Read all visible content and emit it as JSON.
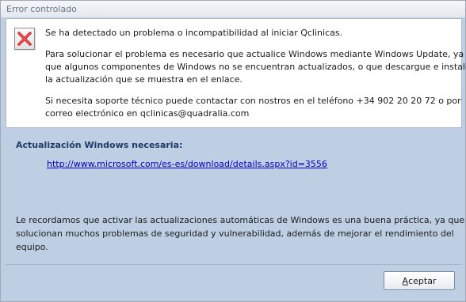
{
  "window": {
    "title": "Error controlado"
  },
  "message": {
    "icon": "error-x-icon",
    "line1": "Se ha detectado un problema o incompatibilidad al iniciar Qclinicas.",
    "para2": [
      "Para solucionar el problema es necesario que actualice Windows mediante Windows Update, ya",
      "que algunos componentes de Windows no se encuentran actualizados, o que descargue e instale",
      "la actualización que se muestra en el enlace."
    ],
    "para3": [
      "Si necesita soporte técnico puede contactar con nostros en el teléfono +34 902 20 20 72 o por",
      "correo electrónico en qclinicas@quadralia.com"
    ]
  },
  "update": {
    "heading": "Actualización Windows necesaria:",
    "link": "http://www.microsoft.com/es-es/download/details.aspx?id=3556"
  },
  "info": [
    "Le recordamos que activar las actualizaciones automáticas de Windows es una buena práctica, ya que se",
    "solucionan muchos problemas de seguridad y vulnerabilidad, además de mejorar el rendimiento del",
    "equipo."
  ],
  "buttons": {
    "accept_first": "A",
    "accept_rest": "ceptar"
  },
  "colors": {
    "panel_bg": "#bfcfe3",
    "heading": "#1d3b6a",
    "link": "#0000cc",
    "error_red": "#d8262e"
  }
}
